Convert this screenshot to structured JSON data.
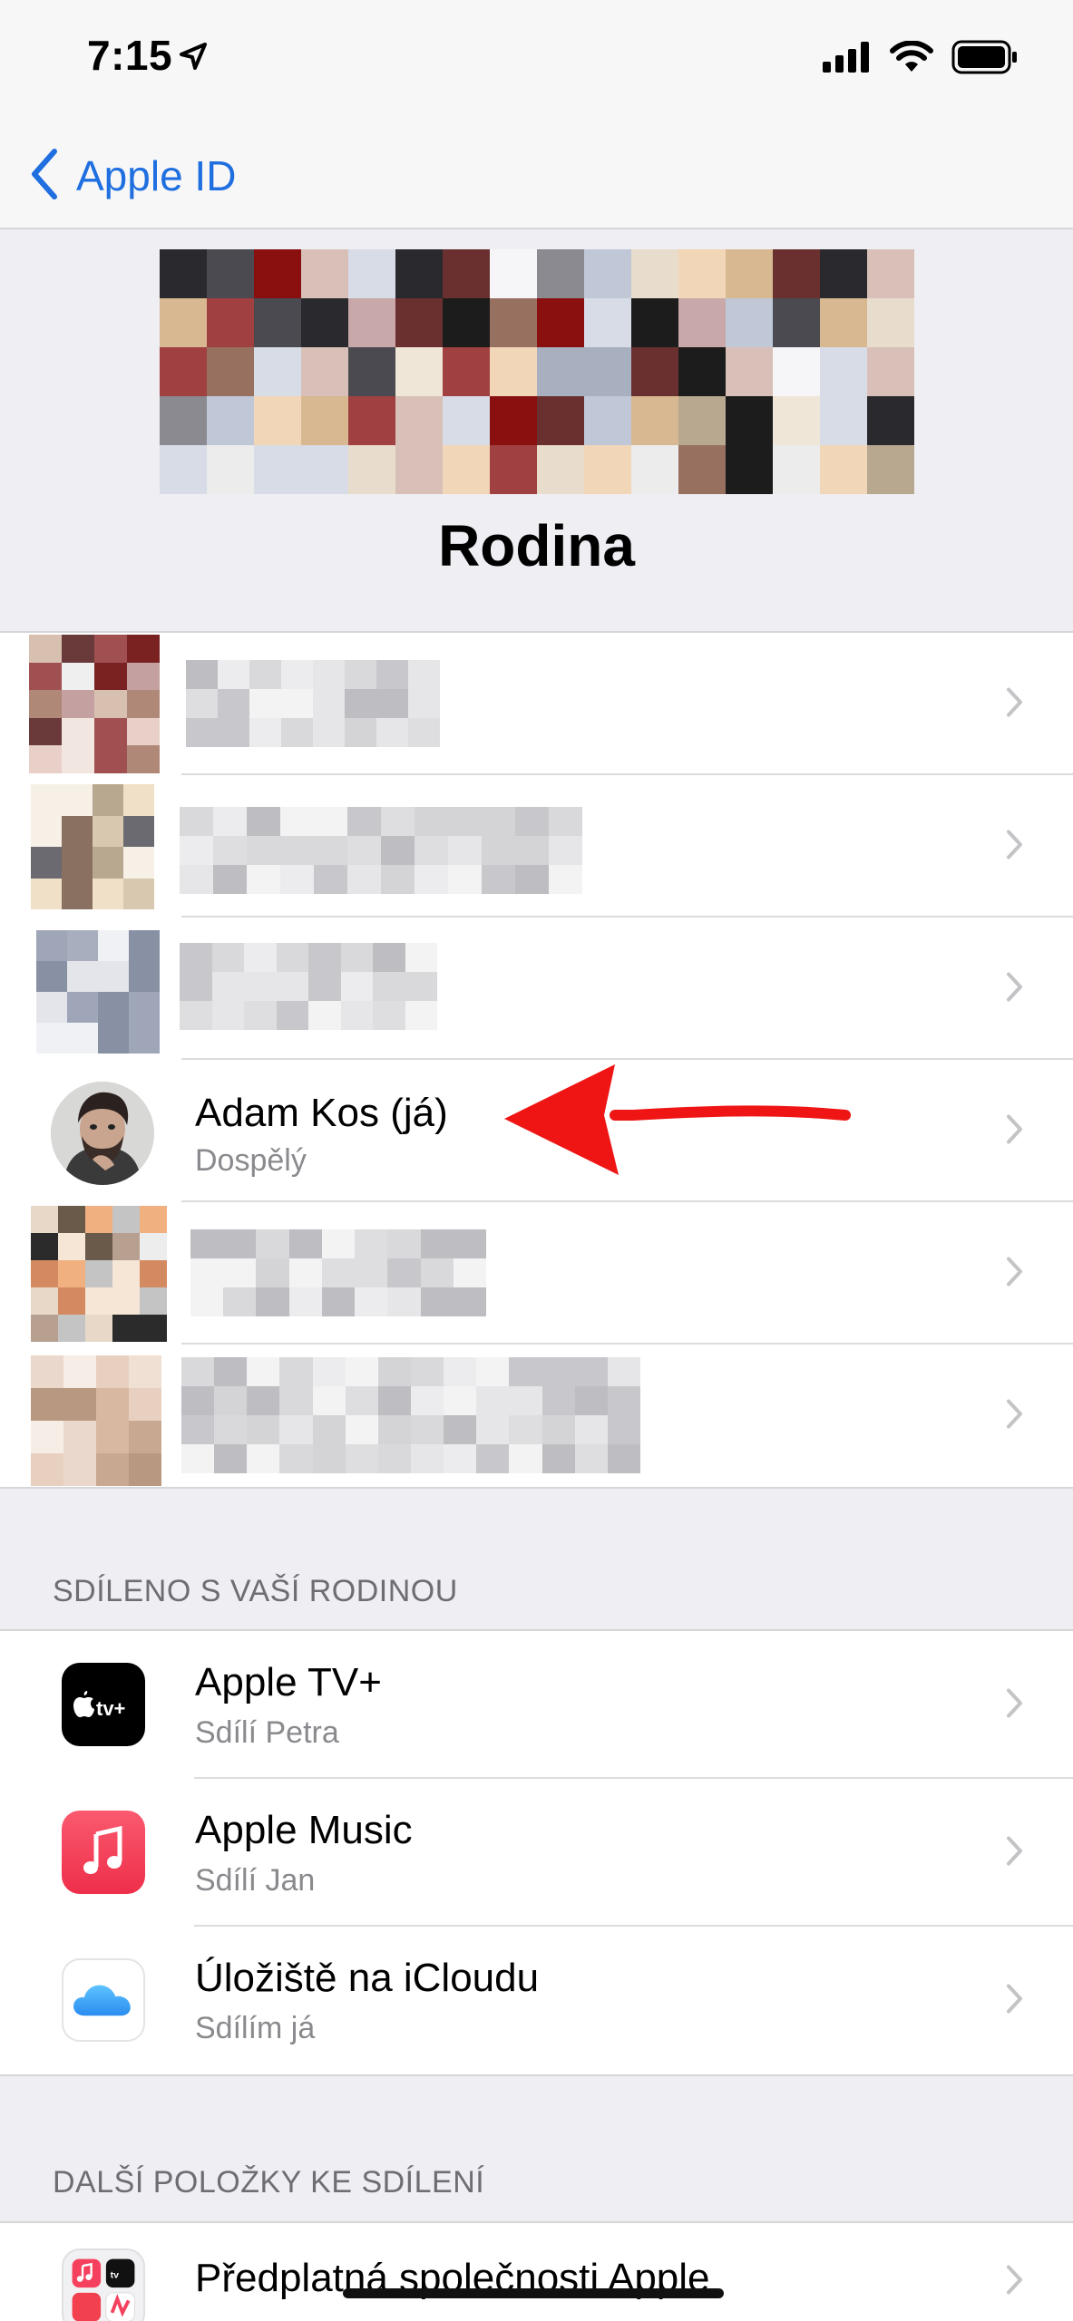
{
  "status": {
    "time": "7:15"
  },
  "nav": {
    "back_label": "Apple ID"
  },
  "header": {
    "title": "Rodina"
  },
  "members": [
    {
      "title": "",
      "subtitle": "",
      "blurred": true
    },
    {
      "title": "",
      "subtitle": "",
      "blurred": true
    },
    {
      "title": "",
      "subtitle": "",
      "blurred": true
    },
    {
      "title": "Adam Kos (já)",
      "subtitle": "Dospělý",
      "blurred": false
    },
    {
      "title": "",
      "subtitle": "",
      "blurred": true
    },
    {
      "title": "",
      "subtitle": "",
      "blurred": true
    }
  ],
  "shared_section": {
    "header": "SDÍLENO S VAŠÍ RODINOU",
    "items": [
      {
        "title": "Apple TV+",
        "subtitle": "Sdílí Petra",
        "icon": "apple-tv-icon"
      },
      {
        "title": "Apple Music",
        "subtitle": "Sdílí Jan",
        "icon": "apple-music-icon"
      },
      {
        "title": "Úložiště na iCloudu",
        "subtitle": "Sdílím já",
        "icon": "icloud-icon"
      }
    ]
  },
  "other_section": {
    "header": "DALŠÍ POLOŽKY KE SDÍLENÍ",
    "items": [
      {
        "title": "Předplatná společnosti Apple",
        "icon": "apple-subscriptions-icon"
      }
    ]
  },
  "colors": {
    "accent": "#1f6fe0",
    "arrow": "#ef1515",
    "music": "#f5415d",
    "background": "#eeeef3"
  }
}
